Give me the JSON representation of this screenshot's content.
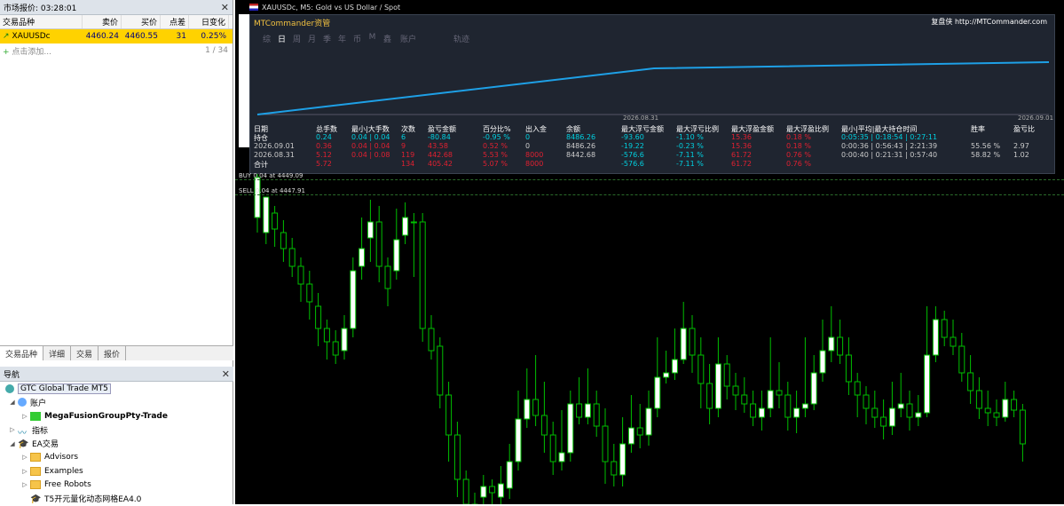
{
  "market_watch": {
    "title": "市场报价: 03:28:01",
    "columns": [
      "交易品种",
      "卖价",
      "买价",
      "点差",
      "日变化"
    ],
    "rows": [
      {
        "symbol": "XAUUSDc",
        "bid": "4460.24",
        "ask": "4460.55",
        "spread": "31",
        "change": "0.25%"
      }
    ],
    "add_label": "点击添加...",
    "count": "1 / 34"
  },
  "tabs": [
    "交易品种",
    "详细",
    "交易",
    "报价"
  ],
  "navigator": {
    "title": "导航",
    "broker": "GTC Global Trade MT5",
    "items": [
      {
        "label": "账户",
        "level": 1
      },
      {
        "label": "MegaFusionGroupPty-Trade",
        "level": 2,
        "bold": true
      },
      {
        "label": "指标",
        "level": 1
      },
      {
        "label": "EA交易",
        "level": 1
      },
      {
        "label": "Advisors",
        "level": 2
      },
      {
        "label": "Examples",
        "level": 2
      },
      {
        "label": "Free Robots",
        "level": 2
      },
      {
        "label": "T5开元量化动态网格EA4.0",
        "level": 2
      }
    ]
  },
  "chart": {
    "title": "XAUUSDc, M5:  Gold vs US Dollar / Spot",
    "buy_line": "BUY 0.04 at 4449.09",
    "sell_line": "SELL 0.04 at 4447.91"
  },
  "mtcommander": {
    "title": "MTCommander资管",
    "link": "复盘侠 http://MTCommander.com",
    "nav": [
      "综",
      "日",
      "周",
      "月",
      "季",
      "年",
      "币",
      "M",
      "鑫",
      "账户",
      "轨迹"
    ],
    "equity_dates": [
      "2026.08.31",
      "2026.09.01"
    ],
    "headers": [
      "日期",
      "总手数",
      "最小|大手数",
      "次数",
      "盈亏金额",
      "百分比%",
      "出入金",
      "余额",
      "最大浮亏金额",
      "最大浮亏比例",
      "最大浮盈金额",
      "最大浮盈比例",
      "最小|平均|最大持仓时间",
      "胜率",
      "盈亏比"
    ],
    "rows": [
      [
        "持仓",
        "0.24",
        "0.04 | 0.04",
        "6",
        "-80.84",
        "-0.95 %",
        "0",
        "8486.26",
        "-93.60",
        "-1.10 %",
        "15.36",
        "0.18 %",
        "0:05:35 | 0:18:54 | 0:27:11",
        "",
        ""
      ],
      [
        "2026.09.01",
        "0.36",
        "0.04 | 0.04",
        "9",
        "43.58",
        "0.52 %",
        "0",
        "8486.26",
        "-19.22",
        "-0.23 %",
        "15.36",
        "0.18 %",
        "0:00:36 | 0:56:43 | 2:21:39",
        "55.56 %",
        "2.97"
      ],
      [
        "2026.08.31",
        "5.12",
        "0.04 | 0.08",
        "119",
        "442.68",
        "5.53 %",
        "8000",
        "8442.68",
        "-576.6",
        "-7.11 %",
        "61.72",
        "0.76 %",
        "0:00:40 | 0:21:31 | 0:57:40",
        "58.82 %",
        "1.02"
      ],
      [
        "合计",
        "5.72",
        "",
        "134",
        "405.42",
        "5.07 %",
        "8000",
        "",
        "-576.6",
        "-7.11 %",
        "61.72",
        "0.76 %",
        "",
        "",
        ""
      ]
    ]
  },
  "colors": {
    "bull": "#ffffff",
    "bear": "#000000",
    "wick": "#00c000",
    "equity": "#1ea0e6",
    "accent": "#ffd200"
  }
}
